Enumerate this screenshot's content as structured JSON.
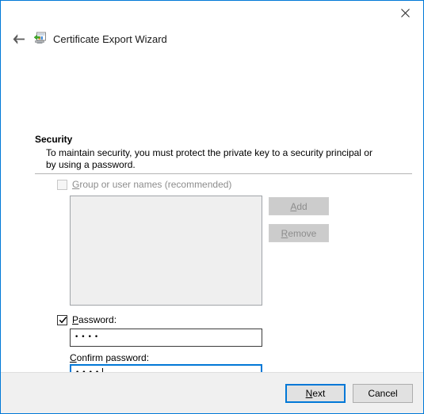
{
  "window": {
    "title": "Certificate Export Wizard",
    "border_color": "#0078d7",
    "icon_name": "certificate-export-icon"
  },
  "titlebar": {
    "close_label": "Close",
    "close_icon": "close-icon"
  },
  "navigation": {
    "back_label": "Back",
    "back_icon": "back-arrow-icon"
  },
  "page": {
    "heading": "Security",
    "description": "To maintain security, you must protect the private key to a security principal or by using a password."
  },
  "groups": {
    "checkbox_label_pre": "G",
    "checkbox_label_post": "roup or user names (recommended)",
    "checkbox_checked": false,
    "checkbox_enabled": false,
    "list_items": [],
    "add_label_pre": "A",
    "add_label_post": "dd",
    "add_enabled": false,
    "remove_label_pre": "R",
    "remove_label_post": "emove",
    "remove_enabled": false
  },
  "password": {
    "checkbox_label_pre": "P",
    "checkbox_label_post": "assword:",
    "checkbox_checked": true,
    "checkbox_enabled": true,
    "value_masked": "••••",
    "char_count": 4
  },
  "confirm_password": {
    "label_pre": "C",
    "label_post": "onfirm password:",
    "value_masked": "••••",
    "char_count": 4,
    "focused": true,
    "focus_color": "#0078d7"
  },
  "footer": {
    "next_label_pre": "N",
    "next_label_post": "ext",
    "cancel_label": "Cancel"
  }
}
